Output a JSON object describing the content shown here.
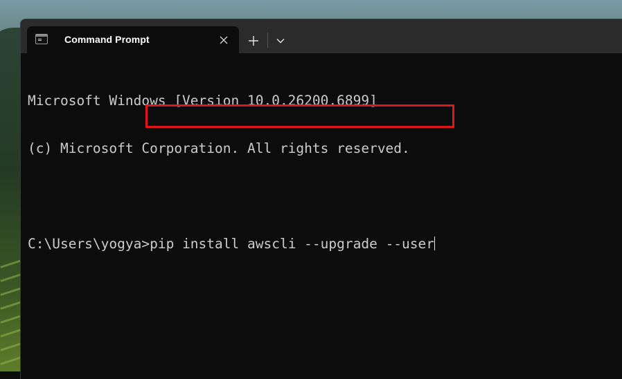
{
  "window": {
    "tab_title": "Command Prompt",
    "tab_close_icon": "close-icon",
    "new_tab_icon": "plus-icon",
    "dropdown_icon": "chevron-down-icon"
  },
  "console": {
    "lines": [
      "Microsoft Windows [Version 10.0.26200.6899]",
      "(c) Microsoft Corporation. All rights reserved.",
      ""
    ],
    "prompt": "C:\\Users\\yogya>",
    "command": "pip install awscli --upgrade --user"
  },
  "colors": {
    "highlight_box": "#e0161c",
    "terminal_bg": "#0c0c0c",
    "terminal_text": "#cccccc",
    "tabbar_bg": "#2b2b2b"
  }
}
